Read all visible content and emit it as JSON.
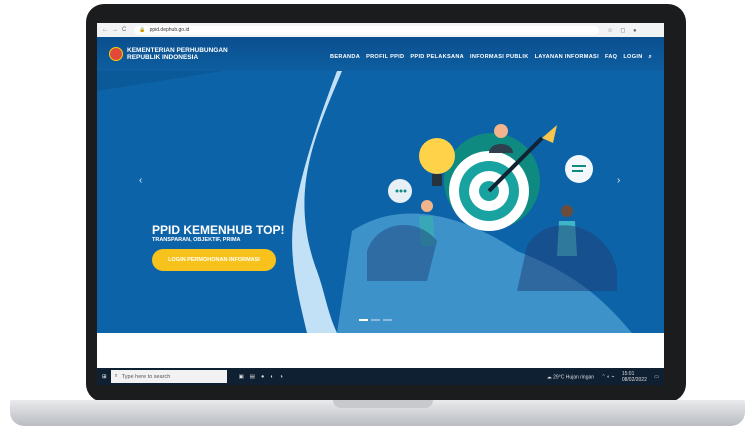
{
  "browser": {
    "url": "ppid.dephub.go.id"
  },
  "site": {
    "brand_line1": "KEMENTERIAN PERHUBUNGAN",
    "brand_line2": "REPUBLIK INDONESIA",
    "menu": [
      "BERANDA",
      "PROFIL PPID",
      "PPID PELAKSANA",
      "INFORMASI PUBLIK",
      "LAYANAN INFORMASI",
      "FAQ",
      "LOGIN"
    ],
    "search_icon": "search-icon"
  },
  "hero": {
    "title": "PPID KEMENHUB TOP!",
    "subtitle": "TRANSPARAN, OBJEKTIF, PRIMA",
    "cta": "LOGIN PERMOHONAN INFORMASI",
    "prev_arrow": "‹",
    "next_arrow": "›",
    "slides": 3,
    "active_slide": 1
  },
  "taskbar": {
    "search_placeholder": "Type here to search",
    "weather": "29°C Hujan ringan",
    "time": "15:01",
    "date": "08/02/2022"
  },
  "colors": {
    "primary": "#0d63a8",
    "accent": "#f6c21b",
    "taskbar": "#102033"
  }
}
